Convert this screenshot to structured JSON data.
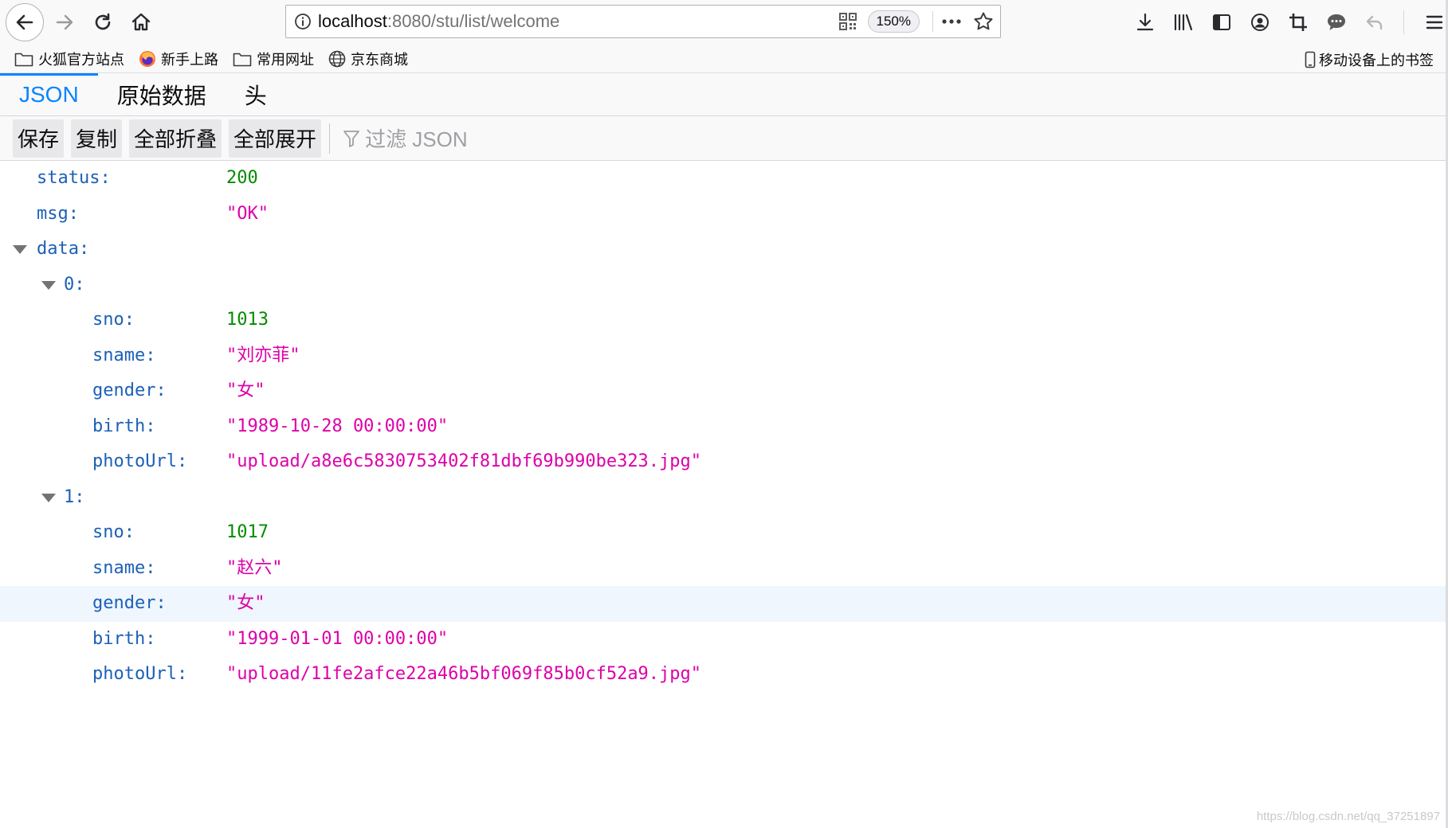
{
  "browser": {
    "url_host": "localhost",
    "url_path": ":8080/stu/list/welcome",
    "zoom": "150%",
    "icons": {
      "back": "arrow-left-icon",
      "forward": "arrow-right-icon",
      "reload": "reload-icon",
      "home": "home-icon",
      "site_info": "info-icon",
      "qr": "qr-code-icon",
      "more": "ellipsis-icon",
      "star": "star-icon",
      "download": "download-icon",
      "library": "library-icon",
      "sidebar": "sidebar-icon",
      "account": "account-icon",
      "screenshot": "crop-icon",
      "chat": "chat-bubble-icon",
      "undo": "undo-icon",
      "menu": "hamburger-menu-icon"
    }
  },
  "bookmarks": {
    "items": [
      {
        "label": "火狐官方站点",
        "icon": "folder-icon"
      },
      {
        "label": "新手上路",
        "icon": "firefox-icon"
      },
      {
        "label": "常用网址",
        "icon": "folder-icon"
      },
      {
        "label": "京东商城",
        "icon": "globe-icon"
      }
    ],
    "mobile": {
      "label": "移动设备上的书签",
      "icon": "mobile-icon"
    }
  },
  "viewer": {
    "tabs": [
      {
        "label": "JSON",
        "active": true
      },
      {
        "label": "原始数据",
        "active": false
      },
      {
        "label": "头",
        "active": false
      }
    ],
    "actions": {
      "save": "保存",
      "copy": "复制",
      "collapse_all": "全部折叠",
      "expand_all": "全部展开",
      "filter_placeholder": "过滤 JSON"
    }
  },
  "tree": {
    "status": {
      "key": "status:",
      "value": "200"
    },
    "msg": {
      "key": "msg:",
      "value": "\"OK\""
    },
    "data": {
      "key": "data:"
    },
    "items": [
      {
        "key": "0:",
        "sno": {
          "key": "sno:",
          "value": "1013"
        },
        "sname": {
          "key": "sname:",
          "value": "\"刘亦菲\""
        },
        "gender": {
          "key": "gender:",
          "value": "\"女\""
        },
        "birth": {
          "key": "birth:",
          "value": "\"1989-10-28 00:00:00\""
        },
        "photoUrl": {
          "key": "photoUrl:",
          "value": "\"upload/a8e6c5830753402f81dbf69b990be323.jpg\""
        }
      },
      {
        "key": "1:",
        "sno": {
          "key": "sno:",
          "value": "1017"
        },
        "sname": {
          "key": "sname:",
          "value": "\"赵六\""
        },
        "gender": {
          "key": "gender:",
          "value": "\"女\""
        },
        "birth": {
          "key": "birth:",
          "value": "\"1999-01-01 00:00:00\""
        },
        "photoUrl": {
          "key": "photoUrl:",
          "value": "\"upload/11fe2afce22a46b5bf069f85b0cf52a9.jpg\""
        }
      }
    ]
  },
  "watermark": "https://blog.csdn.net/qq_37251897",
  "colors": {
    "accent": "#0a84ff",
    "key": "#1c60b7",
    "number": "#058b00",
    "string": "#dd00a9",
    "hover_row": "#eff6fd"
  }
}
